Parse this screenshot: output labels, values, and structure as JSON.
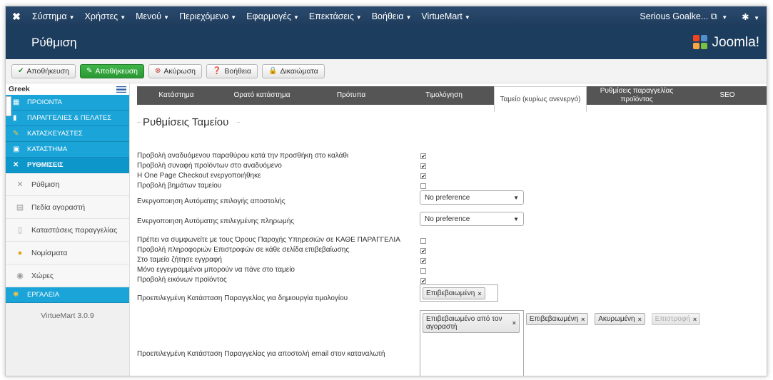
{
  "navbar": {
    "menu": [
      "Σύστημα",
      "Χρήστες",
      "Μενού",
      "Περιεχόμενο",
      "Εφαρμογές",
      "Επεκτάσεις",
      "Βοήθεια",
      "VirtueMart"
    ],
    "user": "Serious Goalke...",
    "external_icon": "external-link-icon",
    "gear_icon": "gear-icon"
  },
  "page": {
    "title": "Ρύθμιση",
    "brand": "Joomla!"
  },
  "toolbar": {
    "save": "Αποθήκευση",
    "save_close": "Αποθήκευση",
    "cancel": "Ακύρωση",
    "help": "Βοήθεια",
    "permissions": "Δικαιώματα"
  },
  "sidebar": {
    "language": "Greek",
    "sections": [
      {
        "label": "ΠΡΟΙΟΝΤΑ"
      },
      {
        "label": "ΠΑΡΑΓΓΕΛΙΕΣ & ΠΕΛΑΤΕΣ"
      },
      {
        "label": "ΚΑΤΑΣΚΕΥΑΣΤΕΣ"
      },
      {
        "label": "ΚΑΤΑΣΤΗΜΑ"
      },
      {
        "label": "ΡΥΘΜΙΣΕΙΣ"
      }
    ],
    "items": [
      {
        "label": "Ρύθμιση"
      },
      {
        "label": "Πεδία αγοραστή"
      },
      {
        "label": "Καταστάσεις παραγγελίας"
      },
      {
        "label": "Νομίσματα"
      },
      {
        "label": "Χώρες"
      }
    ],
    "tools": "ΕΡΓΑΛΕΙΑ",
    "version": "VirtueMart 3.0.9"
  },
  "tabs": [
    {
      "label": "Κατάστημα"
    },
    {
      "label": "Ορατό κατάστημα"
    },
    {
      "label": "Πρότυπα"
    },
    {
      "label": "Τιμολόγηση"
    },
    {
      "label": "Ταμείο (κυρίως ανενεργό)"
    },
    {
      "label": "Ρυθμίσεις παραγγελίας προϊόντος"
    },
    {
      "label": "SEO"
    }
  ],
  "section_title": "Ρυθμίσεις Ταμείου",
  "settings": [
    {
      "label": "Προβολή αναδυόμενου παραθύρου κατά την προσθήκη στο καλάθι",
      "checked": true
    },
    {
      "label": "Προβολή συναφή προϊόντων στο αναδυόμενο",
      "checked": true
    },
    {
      "label": "Η One Page Checkout ενεργοποιήθηκε",
      "checked": true
    },
    {
      "label": "Προβολή βημάτων ταμείου",
      "checked": false
    },
    {
      "label": "Ενεργοποιηση Αυτόματης επιλογής αποστολής",
      "select": "No preference"
    },
    {
      "label": "Ενεργοποιηση Αυτόματης επιλεγμένης πληρωμής",
      "select": "No preference"
    },
    {
      "label": "Πρέπει να συμφωνείτε με τους Όρους Παροχής Υπηρεσιών σε ΚΑΘΕ ΠΑΡΑΓΓΕΛΙΑ",
      "checked": false
    },
    {
      "label": "Προβολή πληροφοριών Επιστροφών σε κάθε σελίδα επιβεβαίωσης",
      "checked": true
    },
    {
      "label": "Στο ταμείο ζήτησε εγγραφή",
      "checked": true
    },
    {
      "label": "Μόνο εγγεγραμμένοι μπορούν να πάνε στο ταμείο",
      "checked": false
    },
    {
      "label": "Προβολή εικόνων προϊόντος",
      "checked": true
    },
    {
      "label": "Προεπιλεγμένη Κατάσταση Παραγγελίας για δημιουργία τιμολογίου",
      "tags": [
        "Επιβεβαιωμένη"
      ]
    },
    {
      "label": "Προεπιλεγμένη Κατάσταση Παραγγελίας για αποστολή email στον καταναλωτή",
      "tags": [
        "Επιβεβαιωμένο από τον αγοραστή",
        "Επιβεβαιωμένη",
        "Ακυρωμένη",
        "Επιστροφή"
      ]
    }
  ],
  "colors": {
    "navbar": "#2a4a6e",
    "subheader": "#1c3d5e",
    "sidebar_section": "#1aa4d8",
    "tab_bar": "#555555",
    "save_green": "#2a9834"
  }
}
